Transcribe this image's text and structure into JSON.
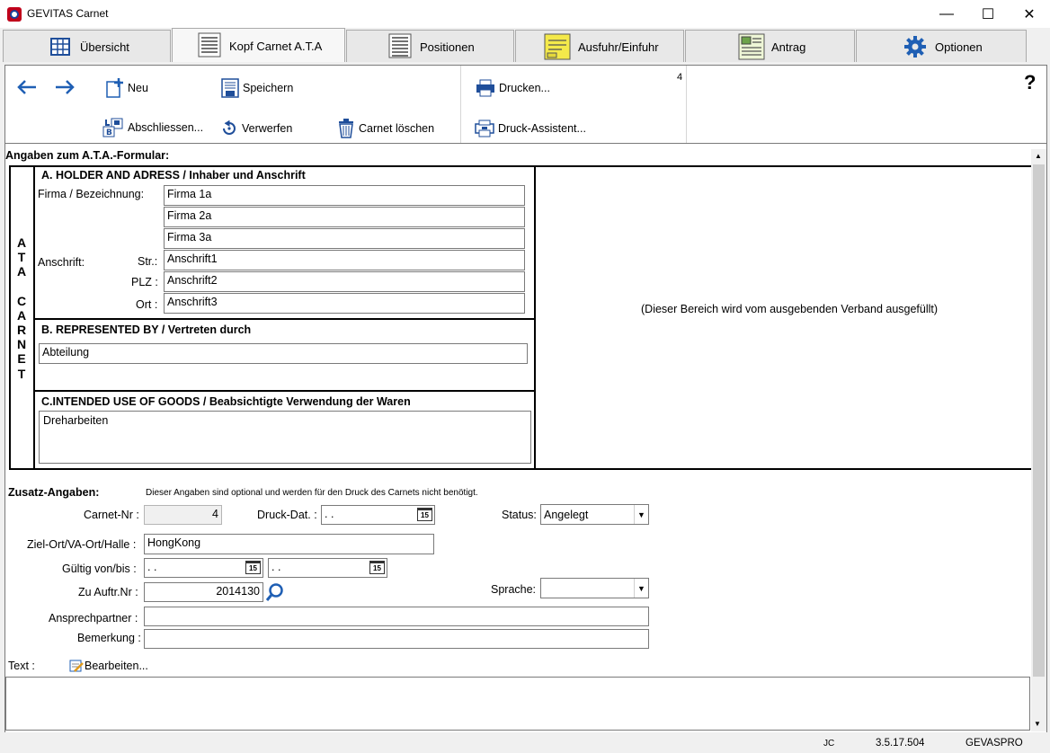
{
  "window": {
    "title": "GEVITAS Carnet",
    "minimize": "—",
    "maximize": "☐",
    "close": "✕"
  },
  "tabs": [
    {
      "label": "Übersicht"
    },
    {
      "label": "Kopf Carnet A.T.A"
    },
    {
      "label": "Positionen"
    },
    {
      "label": "Ausfuhr/Einfuhr"
    },
    {
      "label": "Antrag"
    },
    {
      "label": "Optionen"
    }
  ],
  "toolbar": {
    "back": "←",
    "forward": "→",
    "new": "Neu",
    "save": "Speichern",
    "print": "Drucken...",
    "close_out": "Abschliessen...",
    "discard": "Verwerfen",
    "delete": "Carnet löschen",
    "print_wizard": "Druck-Assistent...",
    "count": "4",
    "help": "?"
  },
  "form": {
    "heading": "Angaben zum A.T.A.-Formular:",
    "side_label": [
      "A",
      "T",
      "A",
      "",
      "C",
      "A",
      "R",
      "N",
      "E",
      "T"
    ],
    "section_a": {
      "title": "A. HOLDER AND ADRESS / Inhaber und Anschrift",
      "firma_label": "Firma / Bezeichnung:",
      "firma1": "Firma 1a",
      "firma2": "Firma 2a",
      "firma3": "Firma 3a",
      "anschrift_label": "Anschrift:",
      "str_label": "Str.:",
      "plz_label": "PLZ :",
      "ort_label": "Ort :",
      "str": "Anschrift1",
      "plz": "Anschrift2",
      "ort": "Anschrift3"
    },
    "section_b": {
      "title": "B. REPRESENTED BY / Vertreten durch",
      "value": "Abteilung"
    },
    "section_c": {
      "title": "C.INTENDED USE OF GOODS / Beabsichtigte Verwendung der Waren",
      "value": "Dreharbeiten"
    },
    "issuer_note": "(Dieser Bereich wird vom ausgebenden Verband ausgefüllt)"
  },
  "extra": {
    "title": "Zusatz-Angaben:",
    "note": "Dieser Angaben sind optional und werden für den Druck des Carnets nicht benötigt.",
    "carnet_nr_label": "Carnet-Nr :",
    "carnet_nr": "4",
    "druck_dat_label": "Druck-Dat. :",
    "druck_dat": " .  .",
    "status_label": "Status:",
    "status": "Angelegt",
    "ziel_label": "Ziel-Ort/VA-Ort/Halle :",
    "ziel": "HongKong",
    "gueltig_label": "Gültig von/bis :",
    "gueltig_von": " .  .",
    "gueltig_bis": " .  .",
    "auftr_label": "Zu Auftr.Nr :",
    "auftr": "2014130",
    "sprache_label": "Sprache:",
    "sprache": "",
    "ansprech_label": "Ansprechpartner :",
    "ansprech": "",
    "bemerkung_label": "Bemerkung :",
    "bemerkung": "",
    "text_label": "Text :",
    "edit": "Bearbeiten...",
    "text_value": ""
  },
  "status": {
    "user": "JC",
    "version": "3.5.17.504",
    "db": "GEVASPRO"
  }
}
